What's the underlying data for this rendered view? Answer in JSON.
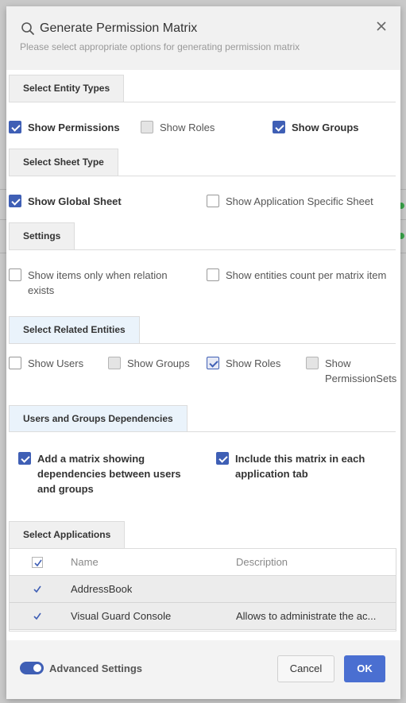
{
  "dialog": {
    "title": "Generate Permission Matrix",
    "subtitle": "Please select appropriate options for generating permission matrix"
  },
  "sections": {
    "entity_types": {
      "tab": "Select Entity Types",
      "options": [
        {
          "label": "Show Permissions",
          "checked": true
        },
        {
          "label": "Show Roles",
          "checked": false
        },
        {
          "label": "Show Groups",
          "checked": true
        }
      ]
    },
    "sheet_type": {
      "tab": "Select Sheet Type",
      "options": [
        {
          "label": "Show Global Sheet",
          "checked": true
        },
        {
          "label": "Show Application Specific Sheet",
          "checked": false
        }
      ]
    },
    "settings": {
      "tab": "Settings",
      "options": [
        {
          "label_line1": "Show items only when relation",
          "label_line2": "exists",
          "checked": false
        },
        {
          "label": "Show entities count per matrix item",
          "checked": false
        }
      ]
    },
    "related_entities": {
      "tab": "Select Related Entities",
      "options": [
        {
          "label": "Show Users",
          "checked": false
        },
        {
          "label": "Show Groups",
          "checked": false
        },
        {
          "label": "Show Roles",
          "checked": true
        },
        {
          "label_line1": "Show",
          "label_line2": "PermissionSets",
          "checked": false
        }
      ]
    },
    "dependencies": {
      "tab": "Users and Groups Dependencies",
      "options": [
        {
          "label_line1": "Add a matrix showing",
          "label_line2": "dependencies between users",
          "label_line3": "and groups",
          "checked": true
        },
        {
          "label_line1": "Include this matrix in each",
          "label_line2": "application tab",
          "checked": true
        }
      ]
    },
    "applications": {
      "tab": "Select Applications",
      "columns": [
        "Name",
        "Description"
      ],
      "rows": [
        {
          "name": "AddressBook",
          "description": "",
          "checked": true
        },
        {
          "name": "Visual Guard Console",
          "description": "Allows to administrate the ac...",
          "checked": true
        }
      ]
    }
  },
  "footer": {
    "advanced_label": "Advanced Settings",
    "advanced_on": true,
    "cancel_label": "Cancel",
    "ok_label": "OK"
  },
  "colors": {
    "accent": "#3f5fb5",
    "ok_button": "#4a6fd1"
  },
  "icons": {
    "search": "search-icon",
    "close": "close-icon"
  }
}
